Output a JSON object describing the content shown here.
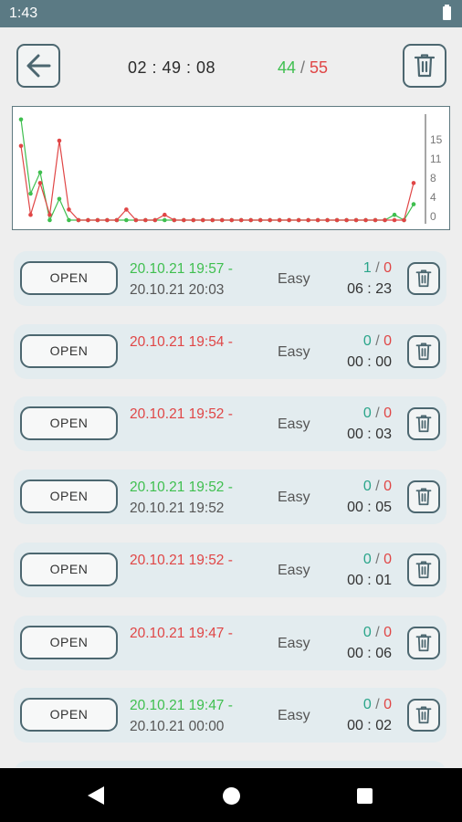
{
  "status_bar": {
    "time": "1:43",
    "icons": [
      "battery-icon"
    ]
  },
  "header": {
    "back_icon": "arrow-left-icon",
    "timer": "02 : 49 : 08",
    "score_correct": "44",
    "score_sep": " / ",
    "score_wrong": "55",
    "delete_icon": "trash-icon"
  },
  "colors": {
    "correct": "#3fbf4f",
    "wrong": "#e04646",
    "teal": "#2aa58a",
    "accent": "#4c6770",
    "status_bar": "#5b7a84"
  },
  "chart_data": {
    "type": "line",
    "ytick_labels": [
      "15",
      "11",
      "8",
      "4",
      "0"
    ],
    "ylim": [
      0,
      20
    ],
    "x": [
      1,
      2,
      3,
      4,
      5,
      6,
      7,
      8,
      9,
      10,
      11,
      12,
      13,
      14,
      15,
      16,
      17,
      18,
      19,
      20,
      21,
      22,
      23,
      24,
      25,
      26,
      27,
      28,
      29,
      30,
      31,
      32,
      33,
      34,
      35,
      36,
      37,
      38,
      39,
      40,
      41,
      42
    ],
    "series": [
      {
        "color": "#3fbf4f",
        "values": [
          19,
          5,
          9,
          0,
          4,
          0,
          0,
          0,
          0,
          0,
          0,
          0,
          0,
          0,
          0,
          0,
          0,
          0,
          0,
          0,
          0,
          0,
          0,
          0,
          0,
          0,
          0,
          0,
          0,
          0,
          0,
          0,
          0,
          0,
          0,
          0,
          0,
          0,
          0,
          1,
          0,
          3
        ]
      },
      {
        "color": "#e04646",
        "values": [
          14,
          1,
          7,
          1,
          15,
          2,
          0,
          0,
          0,
          0,
          0,
          2,
          0,
          0,
          0,
          1,
          0,
          0,
          0,
          0,
          0,
          0,
          0,
          0,
          0,
          0,
          0,
          0,
          0,
          0,
          0,
          0,
          0,
          0,
          0,
          0,
          0,
          0,
          0,
          0,
          0,
          7
        ]
      }
    ],
    "grid": false,
    "legend": "none"
  },
  "list": {
    "rows": [
      {
        "open_label": "OPEN",
        "date_start": "20.10.21 19:57 -",
        "date_start_color": "green",
        "date_end": "20.10.21 20:03",
        "difficulty": "Easy",
        "correct": "1",
        "sep": " / ",
        "wrong": "0",
        "duration": "06 : 23"
      },
      {
        "open_label": "OPEN",
        "date_start": "20.10.21 19:54 -",
        "date_start_color": "red",
        "date_end": "",
        "difficulty": "Easy",
        "correct": "0",
        "sep": " / ",
        "wrong": "0",
        "duration": "00 : 00"
      },
      {
        "open_label": "OPEN",
        "date_start": "20.10.21 19:52 -",
        "date_start_color": "red",
        "date_end": "",
        "difficulty": "Easy",
        "correct": "0",
        "sep": " / ",
        "wrong": "0",
        "duration": "00 : 03"
      },
      {
        "open_label": "OPEN",
        "date_start": "20.10.21 19:52 -",
        "date_start_color": "green",
        "date_end": "20.10.21 19:52",
        "difficulty": "Easy",
        "correct": "0",
        "sep": " / ",
        "wrong": "0",
        "duration": "00 : 05"
      },
      {
        "open_label": "OPEN",
        "date_start": "20.10.21 19:52 -",
        "date_start_color": "red",
        "date_end": "",
        "difficulty": "Easy",
        "correct": "0",
        "sep": " / ",
        "wrong": "0",
        "duration": "00 : 01"
      },
      {
        "open_label": "OPEN",
        "date_start": "20.10.21 19:47 -",
        "date_start_color": "red",
        "date_end": "",
        "difficulty": "Easy",
        "correct": "0",
        "sep": " / ",
        "wrong": "0",
        "duration": "00 : 06"
      },
      {
        "open_label": "OPEN",
        "date_start": "20.10.21 19:47 -",
        "date_start_color": "green",
        "date_end": "20.10.21 00:00",
        "difficulty": "Easy",
        "correct": "0",
        "sep": " / ",
        "wrong": "0",
        "duration": "00 : 02"
      },
      {
        "open_label": "",
        "date_start": "",
        "date_start_color": "red",
        "date_end": "",
        "difficulty": "",
        "correct": "",
        "sep": "",
        "wrong": "",
        "duration": ""
      }
    ]
  },
  "nav_bar": {
    "icons": [
      "back-triangle-icon",
      "home-circle-icon",
      "recents-square-icon"
    ]
  }
}
